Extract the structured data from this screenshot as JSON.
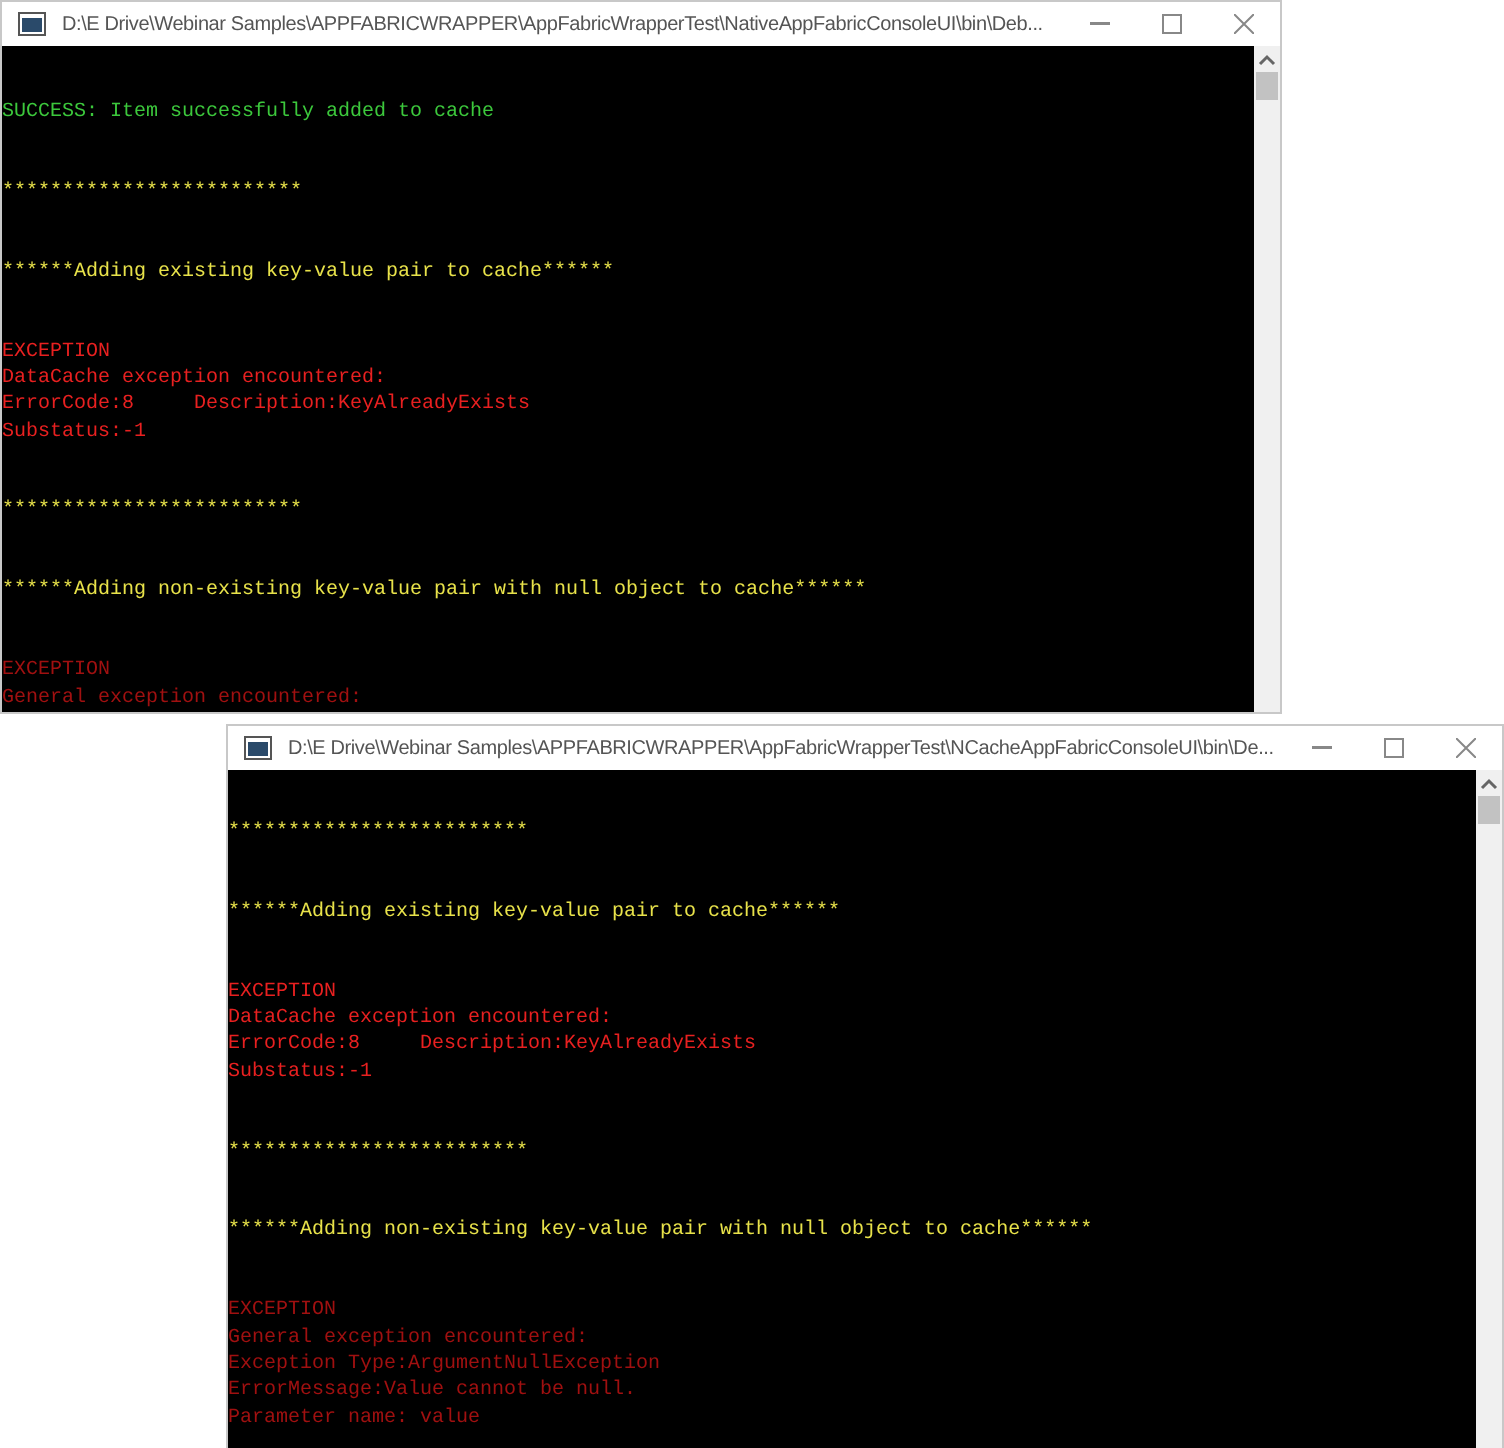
{
  "windows": [
    {
      "title": "D:\\E Drive\\Webinar Samples\\APPFABRICWRAPPER\\AppFabricWrapperTest\\NativeAppFabricConsoleUI\\bin\\Deb...",
      "blocks": [
        {
          "color": "#3cc83c",
          "lines": [
            "SUCCESS: Item successfully added to cache"
          ]
        },
        {
          "color": "#e8e24a",
          "lines": [
            "*************************"
          ]
        },
        {
          "color": "#e8e24a",
          "lines": [
            "******Adding existing key-value pair to cache******"
          ]
        },
        {
          "color": "#e82020",
          "lines": [
            "EXCEPTION",
            "DataCache exception encountered:",
            "ErrorCode:8     Description:KeyAlreadyExists",
            "Substatus:-1"
          ]
        },
        {
          "color": "#e8e24a",
          "lines": [
            "*************************"
          ]
        },
        {
          "color": "#e8e24a",
          "lines": [
            "******Adding non-existing key-value pair with null object to cache******"
          ]
        },
        {
          "color": "#a01010",
          "lines": [
            "EXCEPTION",
            "General exception encountered:"
          ]
        }
      ]
    },
    {
      "title": "D:\\E Drive\\Webinar Samples\\APPFABRICWRAPPER\\AppFabricWrapperTest\\NCacheAppFabricConsoleUI\\bin\\De...",
      "blocks": [
        {
          "color": "#e8e24a",
          "lines": [
            "*************************"
          ]
        },
        {
          "color": "#e8e24a",
          "lines": [
            "******Adding existing key-value pair to cache******"
          ]
        },
        {
          "color": "#e82020",
          "lines": [
            "EXCEPTION",
            "DataCache exception encountered:",
            "ErrorCode:8     Description:KeyAlreadyExists",
            "Substatus:-1"
          ]
        },
        {
          "color": "#e8e24a",
          "lines": [
            "*************************"
          ]
        },
        {
          "color": "#e8e24a",
          "lines": [
            "******Adding non-existing key-value pair with null object to cache******"
          ]
        },
        {
          "color": "#a01010",
          "lines": [
            "EXCEPTION",
            "General exception encountered:",
            "Exception Type:ArgumentNullException",
            "ErrorMessage:Value cannot be null.",
            "Parameter name: value"
          ]
        }
      ]
    }
  ]
}
